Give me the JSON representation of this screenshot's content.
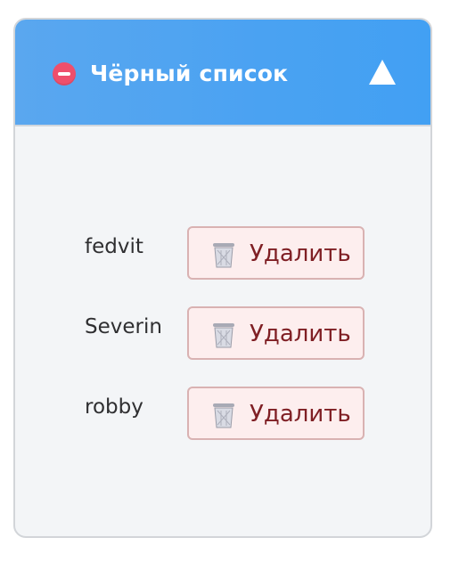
{
  "panel": {
    "title": "Чёрный список",
    "header_icon": "no-entry-icon",
    "toggle_icon": "triangle-up-icon",
    "colors": {
      "header": "#4aa2f2",
      "body": "#f3f5f7",
      "header_icon": "#ef4f6c",
      "delete_background": "#fdeeee",
      "delete_border": "#d9b2b2",
      "delete_text": "#7f1f24"
    }
  },
  "blacklist": {
    "items": [
      {
        "username": "fedvit",
        "delete_label": "Удалить",
        "delete_icon": "wastebasket-icon"
      },
      {
        "username": "Severin",
        "delete_label": "Удалить",
        "delete_icon": "wastebasket-icon"
      },
      {
        "username": "robby",
        "delete_label": "Удалить",
        "delete_icon": "wastebasket-icon"
      }
    ]
  }
}
